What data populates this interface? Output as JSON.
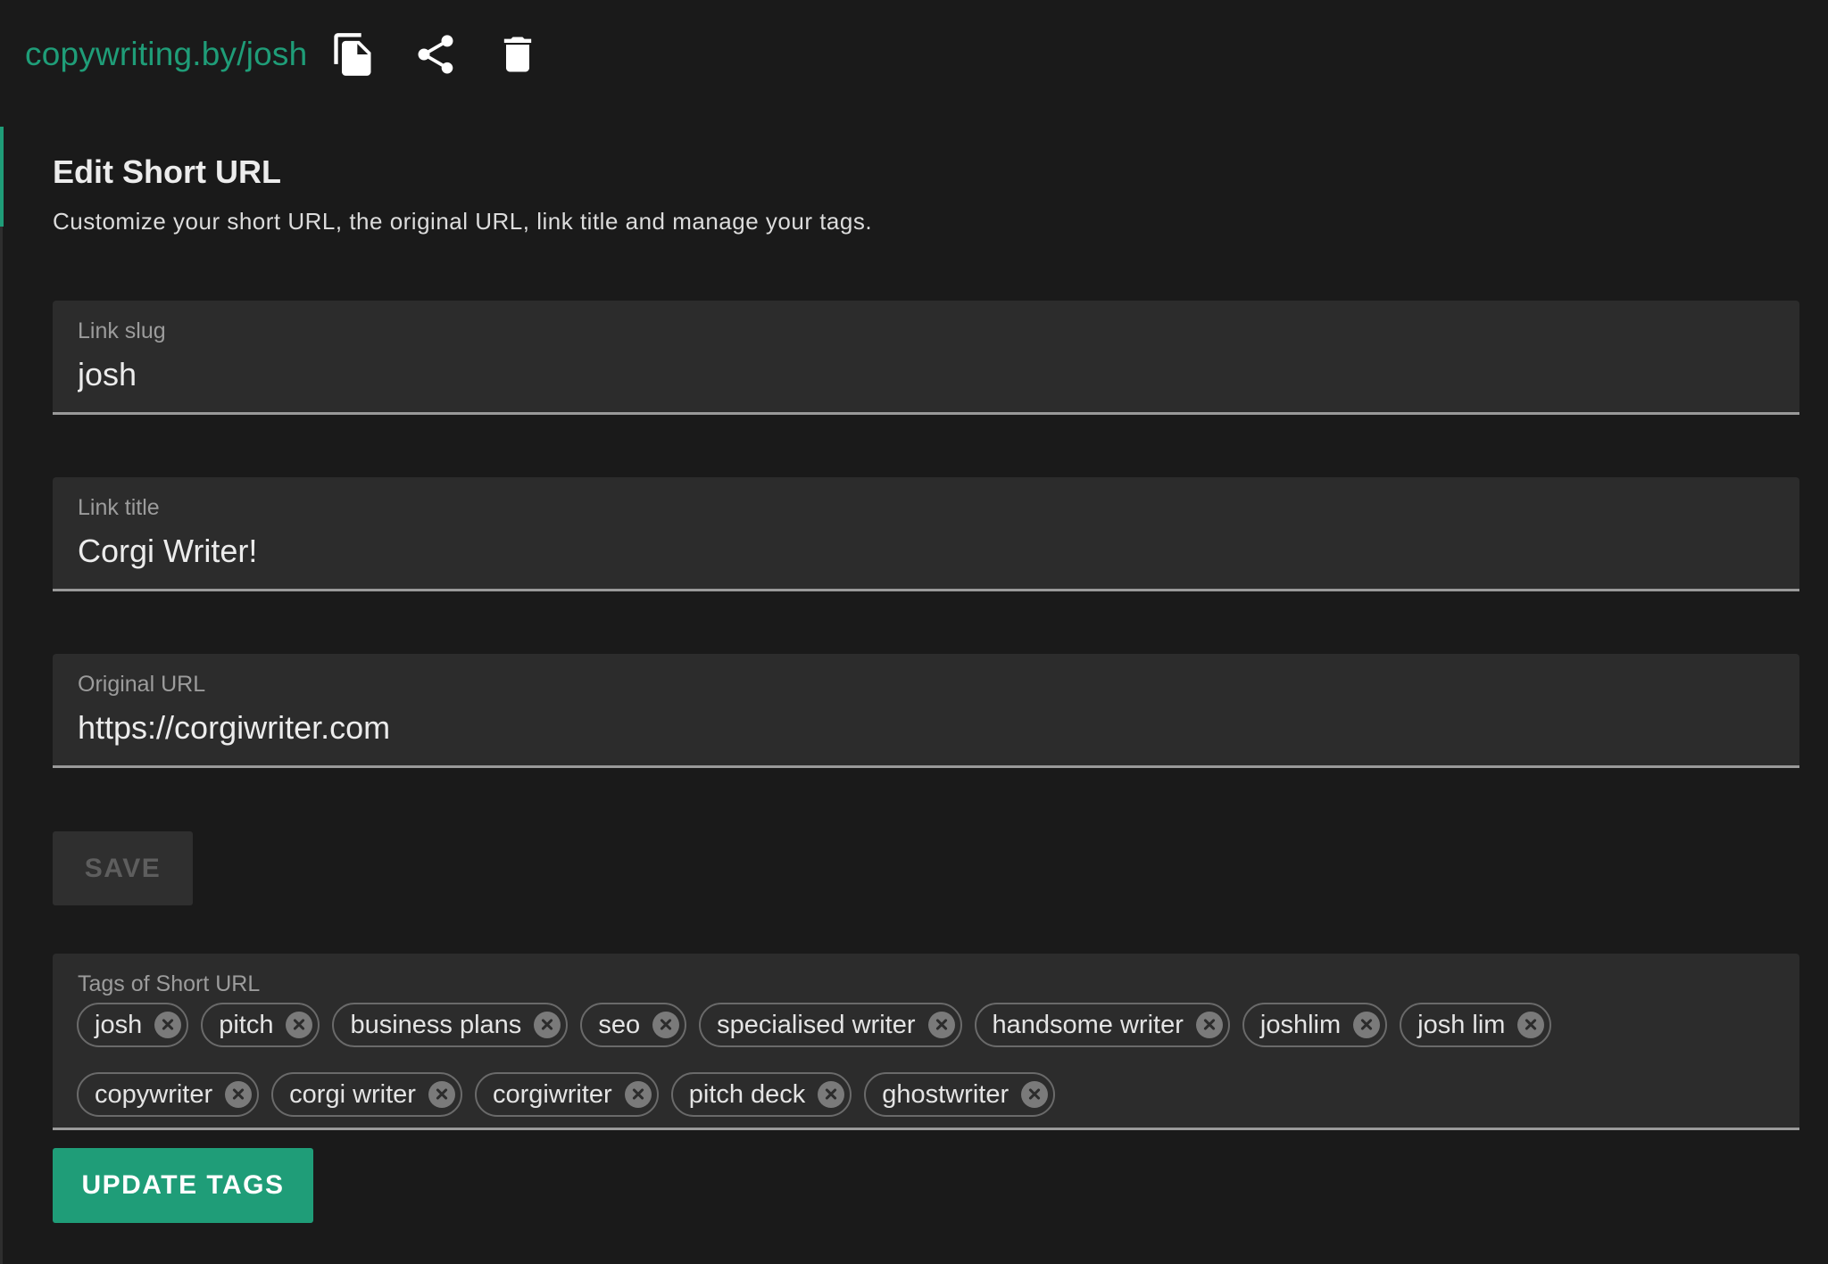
{
  "header": {
    "short_link": "copywriting.by/josh",
    "icons": [
      "copy-icon",
      "share-icon",
      "delete-icon"
    ]
  },
  "edit": {
    "title": "Edit Short URL",
    "subtitle": "Customize your short URL, the original URL, link title and manage your tags."
  },
  "fields": {
    "slug": {
      "label": "Link slug",
      "value": "josh"
    },
    "title": {
      "label": "Link title",
      "value": "Corgi Writer!"
    },
    "original": {
      "label": "Original URL",
      "value": "https://corgiwriter.com"
    }
  },
  "save_button": {
    "label": "SAVE",
    "state": "disabled"
  },
  "tags": {
    "label": "Tags of Short URL",
    "items": [
      "josh",
      "pitch",
      "business plans",
      "seo",
      "specialised writer",
      "handsome writer",
      "joshlim",
      "josh lim",
      "copywriter",
      "corgi writer",
      "corgiwriter",
      "pitch deck",
      "ghostwriter"
    ]
  },
  "update_button": {
    "label": "UPDATE TAGS"
  },
  "colors": {
    "accent": "#1f9d78",
    "background": "#1a1a1a",
    "field_background": "#2c2c2c"
  }
}
